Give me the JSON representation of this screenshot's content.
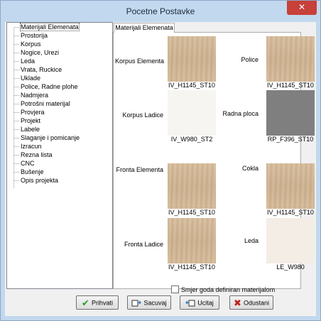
{
  "window": {
    "title": "Pocetne Postavke",
    "close_glyph": "✕"
  },
  "tree": {
    "items": [
      "Materijali Elemenata",
      "Prostorija",
      "Korpus",
      "Nogice, Urezi",
      "Leda",
      "Vrata, Ruckice",
      "Uklade",
      "Police, Radne plohe",
      "Nadmjera",
      "Potrošni materijal",
      "Provjera",
      "Projekt",
      "Labele",
      "Slaganje i pomicanje",
      "Izracun",
      "Rezna lista",
      "CNC",
      "Bušenje",
      "Opis projekta"
    ],
    "selected_index": 0
  },
  "tab": {
    "label": "Materijali Elemenata"
  },
  "materials": {
    "korpus_elementa": {
      "label": "Korpus Elementa",
      "code": "IV_H1145_ST10",
      "swatch": "wood"
    },
    "police": {
      "label": "Police",
      "code": "IV_H1145_ST10",
      "swatch": "wood"
    },
    "korpus_ladice": {
      "label": "Korpus Ladice",
      "code": "IV_W980_ST2",
      "swatch": "white"
    },
    "radna_ploca": {
      "label": "Radna ploca",
      "code": "RP_F396_ST10",
      "swatch": "grey"
    },
    "fronta_elementa": {
      "label": "Fronta Elementa",
      "code": "IV_H1145_ST10",
      "swatch": "wood"
    },
    "cokla": {
      "label": "Cokla",
      "code": "IV_H1145_ST10",
      "swatch": "wood"
    },
    "fronta_ladice": {
      "label": "Fronta Ladice",
      "code": "IV_H1145_ST10",
      "swatch": "wood"
    },
    "leda": {
      "label": "Leda",
      "code": "LE_W980",
      "swatch": "cream"
    }
  },
  "checkbox": {
    "label": "Smjer goda definiran materijalom",
    "checked": false
  },
  "buttons": {
    "prihvati": "Prihvati",
    "sacuvaj": "Sacuvaj",
    "ucitaj": "Ucitaj",
    "odustani": "Odustani"
  },
  "icons": {
    "prihvati": "check-icon",
    "sacuvaj": "save-icon",
    "ucitaj": "load-icon",
    "odustani": "x-icon"
  },
  "colors": {
    "frame": "#c2d8ee",
    "close_button": "#c7403a",
    "wood": "#d3b896",
    "grey_material": "#7f7f7f"
  }
}
